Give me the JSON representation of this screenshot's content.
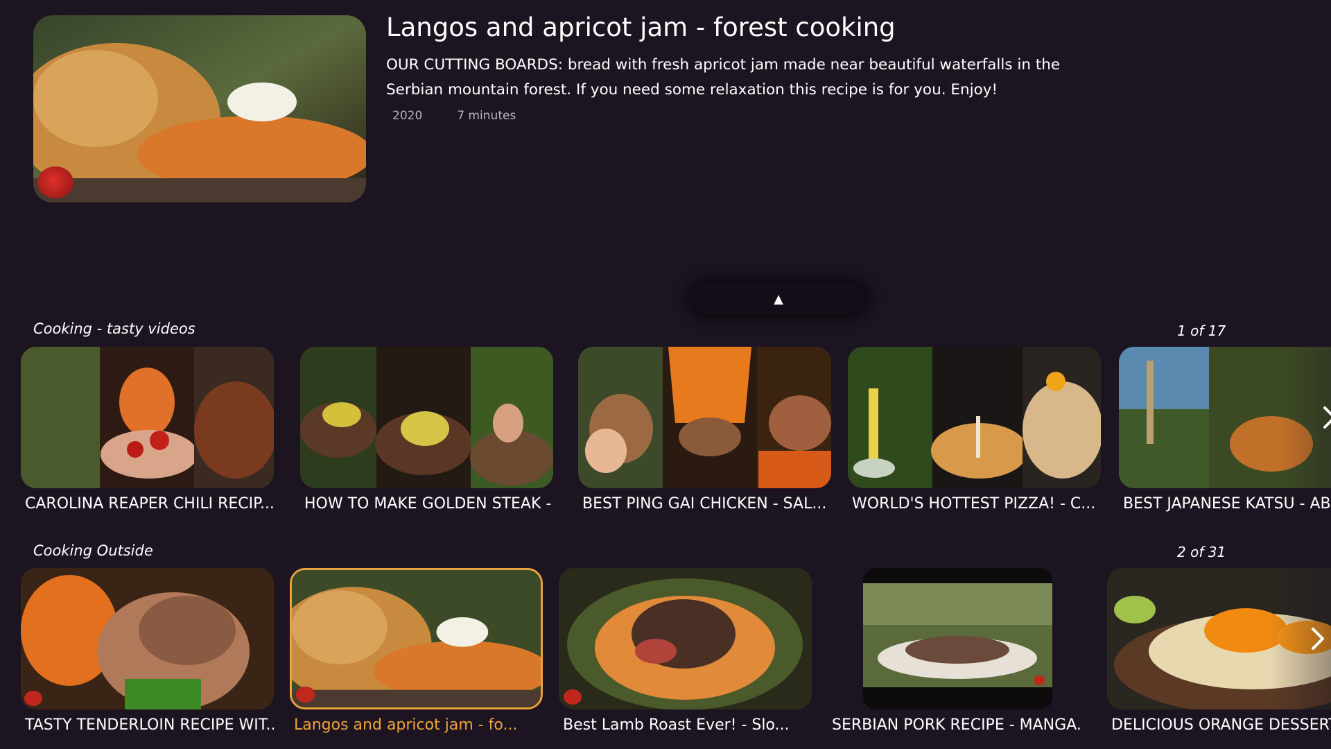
{
  "hero": {
    "title": "Langos and apricot jam - forest cooking",
    "description": "OUR CUTTING BOARDS: bread with fresh apricot jam made near beautiful waterfalls in the Serbian mountain forest. If you need some relaxation this recipe is for you. Enjoy!",
    "year": "2020",
    "duration": "7 minutes",
    "collapse_icon": "▲"
  },
  "rows": [
    {
      "title": "Cooking - tasty videos",
      "counter": "1 of 17",
      "items": [
        {
          "label": "CAROLINA REAPER CHILI RECIP..."
        },
        {
          "label": "HOW TO MAKE GOLDEN STEAK - ..."
        },
        {
          "label": "BEST PING GAI CHICKEN - SAL..."
        },
        {
          "label": "WORLD'S HOTTEST PIZZA! - C..."
        },
        {
          "label": "BEST JAPANESE KATSU - ABA"
        }
      ]
    },
    {
      "title": "Cooking Outside",
      "counter": "2 of 31",
      "items": [
        {
          "label": "TASTY TENDERLOIN RECIPE WIT..."
        },
        {
          "label": "Langos and apricot jam - fo..."
        },
        {
          "label": "Best Lamb Roast Ever! - Slo..."
        },
        {
          "label": "SERBIAN PORK RECIPE - MANGA..."
        },
        {
          "label": "DELICIOUS ORANGE DESSERT"
        }
      ]
    }
  ],
  "colors": {
    "background": "#1d1421",
    "accent": "#e9a33c"
  },
  "icons": [
    "collapse-up-icon",
    "chevron-right-icon",
    "channel-logo-icon"
  ]
}
